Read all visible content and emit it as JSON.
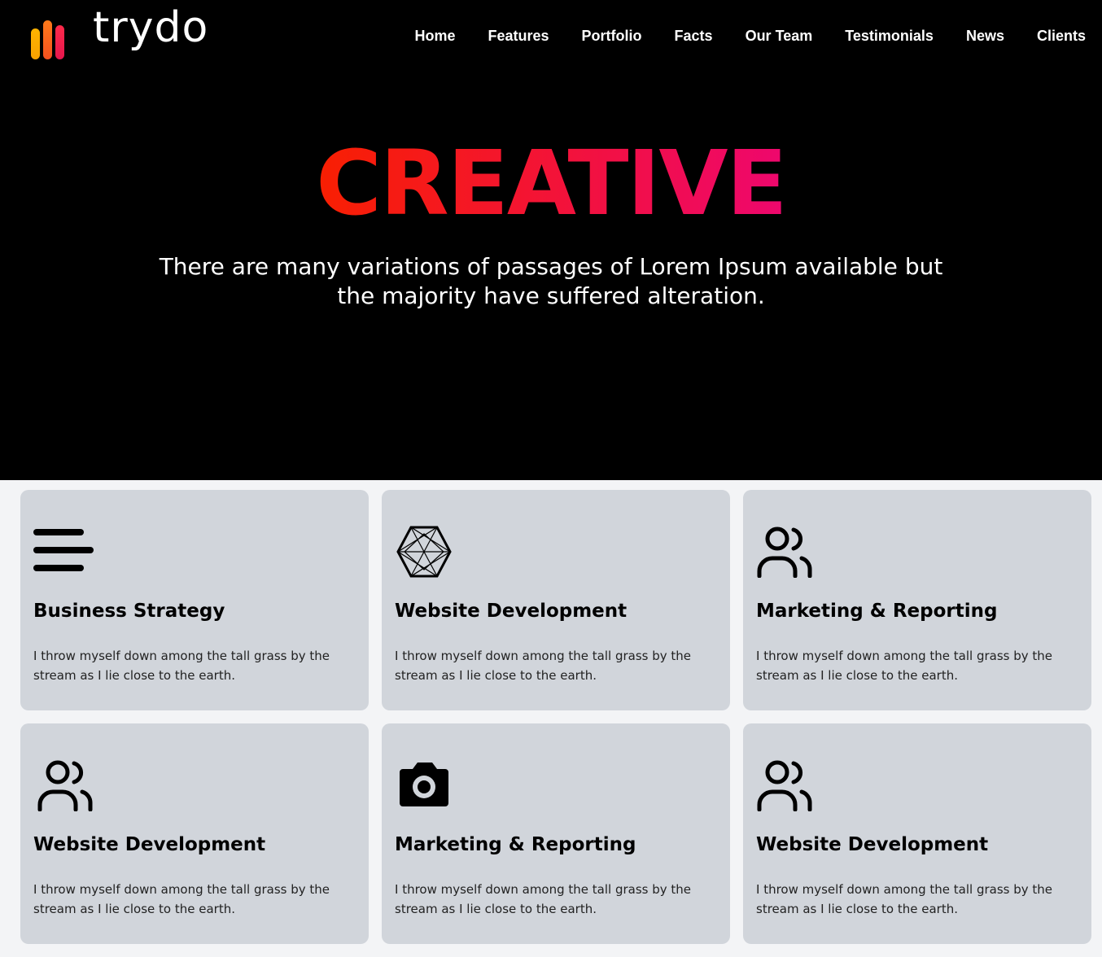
{
  "brand": {
    "name": "trydo"
  },
  "nav": {
    "items": [
      {
        "label": "Home"
      },
      {
        "label": "Features"
      },
      {
        "label": "Portfolio"
      },
      {
        "label": "Facts"
      },
      {
        "label": "Our Team"
      },
      {
        "label": "Testimonials"
      },
      {
        "label": "News"
      },
      {
        "label": "Clients"
      }
    ]
  },
  "hero": {
    "title": "CREATIVE",
    "subtitle": "There are many variations of passages of Lorem Ipsum available but the majority have suffered alteration.",
    "gradient_start": "#f81f01",
    "gradient_end": "#ee076e"
  },
  "cards": [
    {
      "icon": "menu-icon",
      "title": "Business Strategy",
      "text": "I throw myself down among the tall grass by the stream as I lie close to the earth."
    },
    {
      "icon": "polygon-icon",
      "title": "Website Development",
      "text": "I throw myself down among the tall grass by the stream as I lie close to the earth."
    },
    {
      "icon": "users-icon",
      "title": "Marketing & Reporting",
      "text": "I throw myself down among the tall grass by the stream as I lie close to the earth."
    },
    {
      "icon": "users-icon",
      "title": "Website Development",
      "text": "I throw myself down among the tall grass by the stream as I lie close to the earth."
    },
    {
      "icon": "camera-icon",
      "title": "Marketing & Reporting",
      "text": "I throw myself down among the tall grass by the stream as I lie close to the earth."
    },
    {
      "icon": "users-icon",
      "title": "Website Development",
      "text": "I throw myself down among the tall grass by the stream as I lie close to the earth."
    }
  ]
}
